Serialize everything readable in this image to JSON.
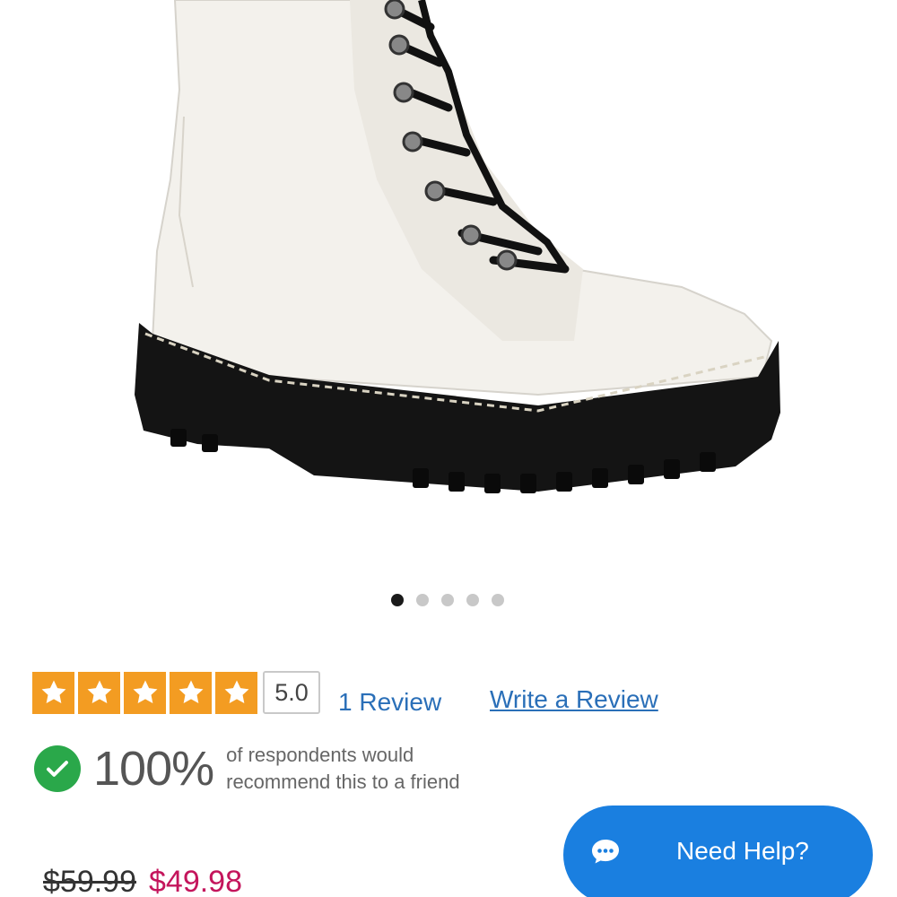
{
  "product_image": {
    "alt": "white combat boot",
    "icon": "boot-photo"
  },
  "carousel": {
    "total": 5,
    "active_index": 0
  },
  "rating": {
    "stars": 5,
    "value": "5.0",
    "review_link": "1 Review",
    "write_review_link": "Write a Review",
    "star_color": "#f39c22"
  },
  "recommend": {
    "percent": "100%",
    "line1": "of respondents would",
    "line2": "recommend this to a friend",
    "check_color": "#2aa84a"
  },
  "price": {
    "original": "$59.99",
    "sale": "$49.98",
    "sale_color": "#c4155c"
  },
  "help": {
    "label": "Need Help?",
    "icon": "chat-bubble-icon",
    "color": "#1a7fe0"
  }
}
